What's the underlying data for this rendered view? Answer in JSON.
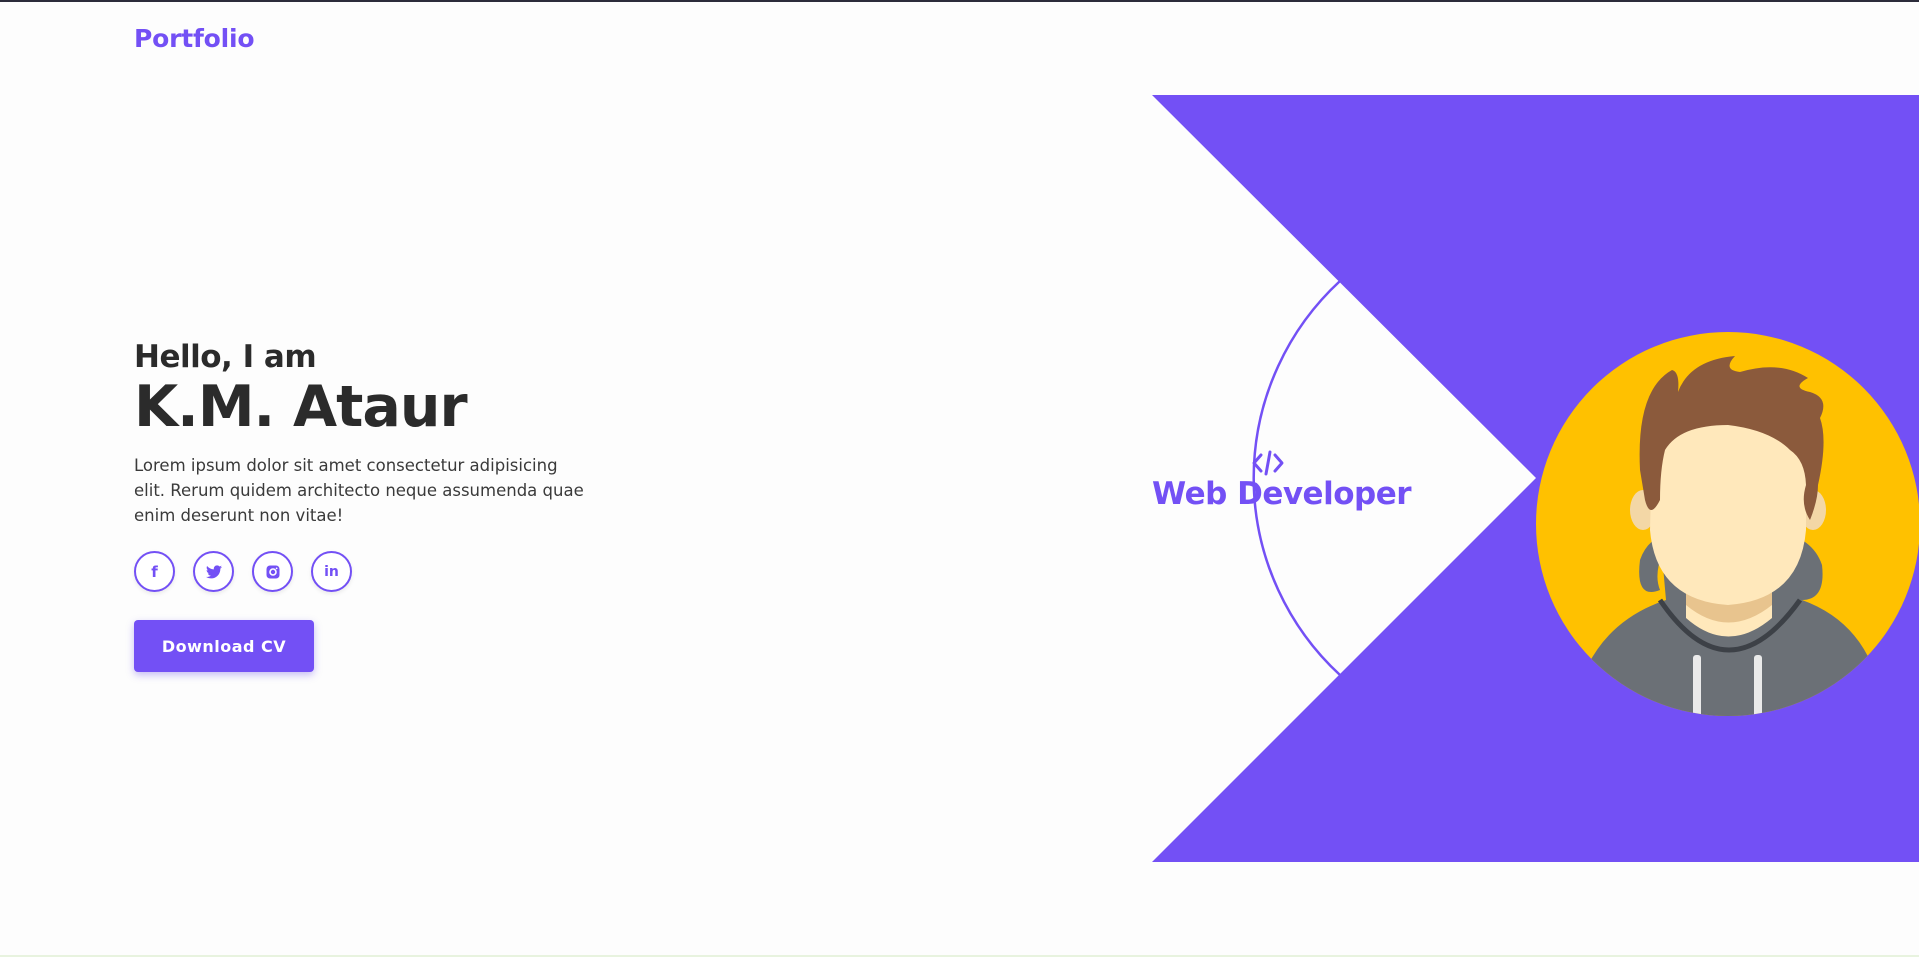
{
  "colors": {
    "accent": "#7350f5",
    "text_dark": "#2b2b2b",
    "avatar_bg": "#ffc100",
    "hair": "#8b5a3c",
    "skin": "#ffe8bb",
    "hoodie": "#6b7076"
  },
  "header": {
    "brand": "Portfolio"
  },
  "hero": {
    "greeting": "Hello, I am",
    "name": "K.M. Ataur",
    "intro": "Lorem ipsum dolor sit amet consectetur adipisicing elit. Rerum quidem architecto neque assumenda quae enim deserunt non vitae!",
    "socials": [
      {
        "icon": "facebook-icon",
        "glyph": "f"
      },
      {
        "icon": "twitter-icon"
      },
      {
        "icon": "instagram-icon"
      },
      {
        "icon": "linkedin-icon",
        "glyph": "in"
      }
    ],
    "cv_button": "Download CV"
  },
  "role": {
    "code_icon": "code-icon",
    "label": "Web Developer"
  },
  "avatar": {
    "icon": "developer-avatar-icon"
  }
}
